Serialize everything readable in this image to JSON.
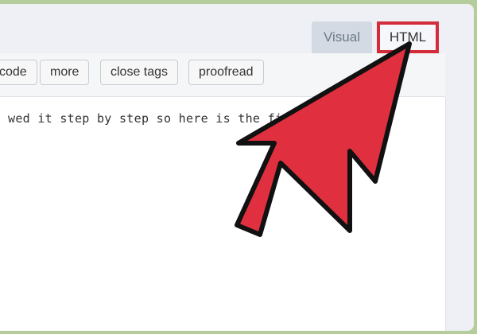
{
  "tabs": {
    "visual_label": "Visual",
    "html_label": "HTML"
  },
  "toolbar": {
    "code_label": "code",
    "more_label": "more",
    "close_tags_label": "close tags",
    "proofread_label": "proofread"
  },
  "editor": {
    "content": "wed it step by step so here is the finished"
  },
  "annotation": {
    "arrow_color": "#e0303f",
    "highlight_color": "#d32d3b",
    "target": "HTML tab"
  }
}
